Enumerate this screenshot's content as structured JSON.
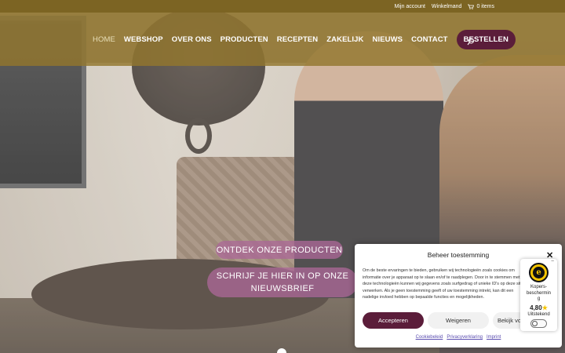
{
  "topbar": {
    "account": "Mijn account",
    "cart": "Winkelmand",
    "items": "0 items"
  },
  "nav": {
    "items": [
      "HOME",
      "WEBSHOP",
      "OVER ONS",
      "PRODUCTEN",
      "RECEPTEN",
      "ZAKELIJK",
      "NIEUWS",
      "CONTACT"
    ],
    "order_button": "BESTELLEN"
  },
  "hero": {
    "cta_products": "ONTDEK ONZE PRODUCTEN",
    "cta_newsletter_line1": "SCHRIJF JE HIER IN OP ONZE",
    "cta_newsletter_line2": "NIEUWSBRIEF"
  },
  "consent": {
    "title": "Beheer toestemming",
    "body": "Om de beste ervaringen te bieden, gebruiken wij technologieën zoals cookies om informatie over je apparaat op te slaan en/of te raadplegen. Door in te stemmen met deze technologieën kunnen wij gegevens zoals surfgedrag of unieke ID's op deze site verwerken. Als je geen toestemming geeft of uw toestemming intrekt, kan dit een nadelige invloed hebben op bepaalde functies en mogelijkheden.",
    "accept": "Accepteren",
    "deny": "Weigeren",
    "view": "Bekijk voorkeuren",
    "links": [
      "Cookiebeleid",
      "Privacyverklaring",
      "Imprint"
    ]
  },
  "trust": {
    "label_line1": "Kopers-",
    "label_line2": "beschermin",
    "label_line3": "g",
    "score": "4,80",
    "rating": "Uitstekend"
  },
  "colors": {
    "header": "#92762d",
    "topbar": "#7c6423",
    "brand_button": "#5b1d3a",
    "cta": "#aa6896"
  }
}
